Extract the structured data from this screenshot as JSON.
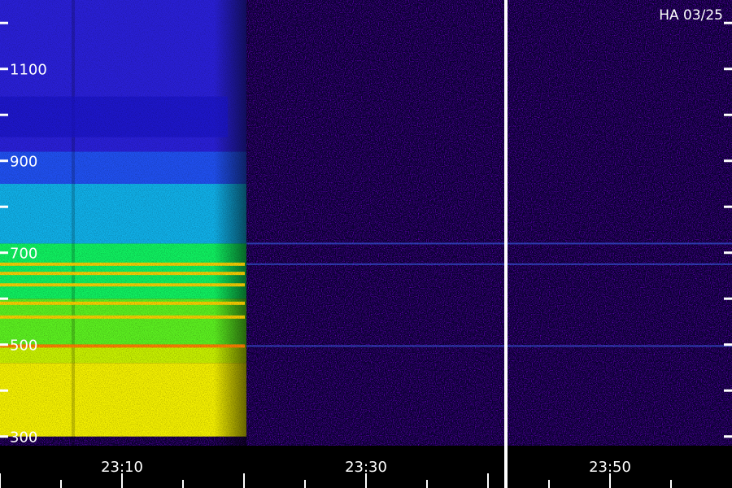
{
  "chart_data": {
    "type": "heatmap",
    "title": "HA 03/25",
    "xlabel": "",
    "ylabel": "",
    "x_axis": {
      "unit": "time",
      "range": [
        "23:00",
        "24:00"
      ],
      "major_tick_labels": [
        "23:10",
        "23:30",
        "23:50"
      ]
    },
    "y_axis": {
      "unit": "frequency",
      "range": [
        280,
        1250
      ],
      "tick_labels": [
        "300",
        "500",
        "700",
        "900",
        "1100"
      ],
      "tick_values": [
        300,
        500,
        700,
        900,
        1100
      ]
    },
    "colormap": [
      "#000033",
      "#2200aa",
      "#2040ff",
      "#00ddff",
      "#00ff44",
      "#ffff00",
      "#ff3300"
    ],
    "background_color": "#000000",
    "separator_time": "23:40",
    "burst": {
      "start_time": "23:00",
      "end_time": "23:20",
      "freq_range": [
        300,
        1250
      ],
      "bands": [
        {
          "freq_low": 300,
          "freq_high": 460,
          "level": "yellow"
        },
        {
          "freq_low": 460,
          "freq_high": 500,
          "level": "yellow-green"
        },
        {
          "freq_low": 500,
          "freq_high": 600,
          "level": "green"
        },
        {
          "freq_low": 600,
          "freq_high": 720,
          "level": "green-cyan"
        },
        {
          "freq_low": 720,
          "freq_high": 850,
          "level": "cyan-blue"
        },
        {
          "freq_low": 850,
          "freq_high": 920,
          "level": "blue"
        },
        {
          "freq_low": 920,
          "freq_high": 1250,
          "level": "blue-violet"
        }
      ],
      "bright_lines_mhz": [
        497,
        560,
        590,
        630,
        655,
        675
      ]
    },
    "persistent_lines_mhz": [
      497,
      675,
      720
    ]
  }
}
